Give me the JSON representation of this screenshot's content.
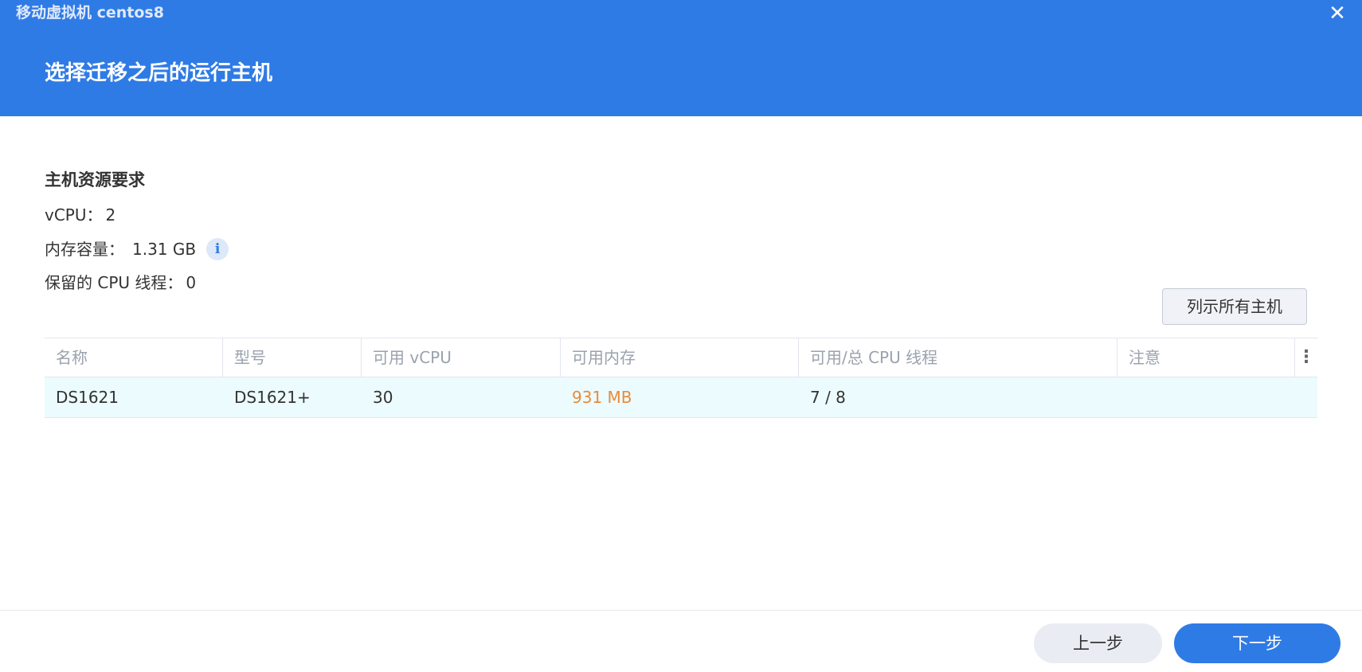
{
  "window": {
    "title": "移动虚拟机 centos8",
    "close_icon": "close-icon"
  },
  "header": {
    "step_title": "选择迁移之后的运行主机",
    "background_color": "#2f7be6"
  },
  "requirements": {
    "title": "主机资源要求",
    "vcpu_label": "vCPU：",
    "vcpu_value": "2",
    "memory_label": "内存容量：",
    "memory_value": "1.31 GB",
    "info_icon": "info-icon",
    "info_glyph": "i",
    "reserved_label": "保留的 CPU 线程：",
    "reserved_value": "0"
  },
  "toolbar": {
    "list_all_label": "列示所有主机"
  },
  "table": {
    "columns": [
      "名称",
      "型号",
      "可用 vCPU",
      "可用内存",
      "可用/总 CPU 线程",
      "注意"
    ],
    "column_menu_glyph": "⋮",
    "rows": [
      {
        "name": "DS1621",
        "model": "DS1621+",
        "vcpu": "30",
        "memory": "931 MB",
        "threads": "7 / 8",
        "note": ""
      }
    ],
    "warning_color": "#ea8a39",
    "selected_row_color": "#ecfbfd"
  },
  "footer": {
    "prev_label": "上一步",
    "next_label": "下一步"
  }
}
